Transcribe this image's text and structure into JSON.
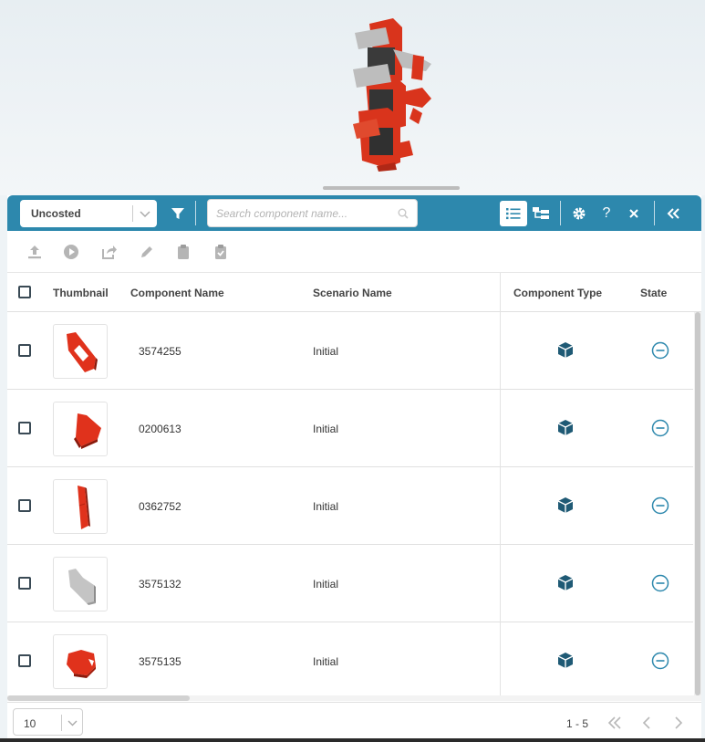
{
  "filter": {
    "selected": "Uncosted"
  },
  "search": {
    "placeholder": "Search component name..."
  },
  "table": {
    "columns": {
      "thumbnail": "Thumbnail",
      "component_name": "Component Name",
      "scenario_name": "Scenario Name",
      "component_type": "Component Type",
      "state": "State"
    },
    "rows": [
      {
        "component_name": "3574255",
        "scenario_name": "Initial",
        "thumb": "red-plate-with-slot",
        "type": "part-icon",
        "state": "minus-circle-icon"
      },
      {
        "component_name": "0200613",
        "scenario_name": "Initial",
        "thumb": "red-wedge",
        "type": "part-icon",
        "state": "minus-circle-icon"
      },
      {
        "component_name": "0362752",
        "scenario_name": "Initial",
        "thumb": "red-bar",
        "type": "part-icon",
        "state": "minus-circle-icon"
      },
      {
        "component_name": "3575132",
        "scenario_name": "Initial",
        "thumb": "grey-bracket",
        "type": "part-icon",
        "state": "minus-circle-icon"
      },
      {
        "component_name": "3575135",
        "scenario_name": "Initial",
        "thumb": "red-block",
        "type": "part-icon",
        "state": "minus-circle-icon"
      }
    ]
  },
  "pagination": {
    "page_size": "10",
    "range": "1 - 5"
  },
  "colors": {
    "toolbar": "#2d88ad",
    "part_red": "#e0321c",
    "icon_dark": "#1f5a75",
    "state_teal": "#2d88ad"
  }
}
